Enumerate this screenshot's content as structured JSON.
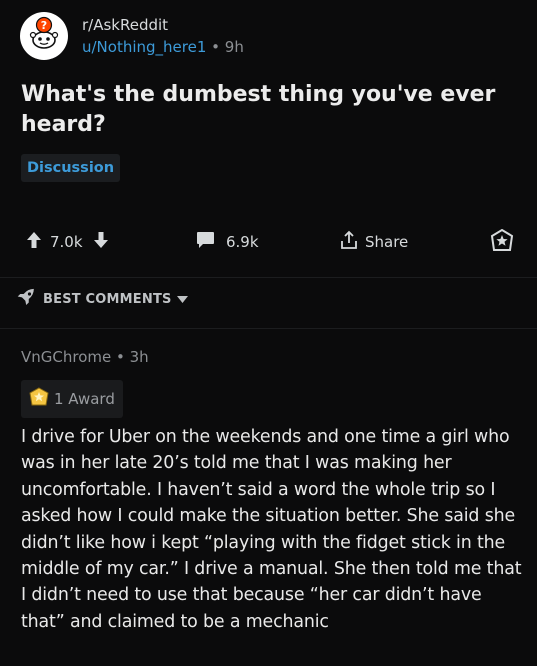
{
  "post": {
    "subreddit": "r/AskReddit",
    "author": "u/Nothing_here1",
    "time": "9h",
    "title": "What's the dumbest thing you've ever heard?",
    "flair": "Discussion",
    "upvotes": "7.0k",
    "comments": "6.9k",
    "share_label": "Share"
  },
  "comments_section": {
    "sort_label": "BEST COMMENTS"
  },
  "comment": {
    "author": "VnGChrome",
    "time": "3h",
    "award": "1 Award",
    "body": "I drive for Uber on the weekends and one time a girl who was in her late 20’s told me that I was making her uncomfortable. I haven’t said a word the whole trip so I asked how I could make the situation better. She said she didn’t like how i kept “playing with the fidget stick in the middle of my car.” I drive a manual. She then told me that I didn’t need to use that because “her car didn’t have that” and claimed to be a mechanic"
  },
  "icons": {
    "avatar": "subreddit-avatar-icon",
    "upvote": "upvote-arrow-icon",
    "downvote": "downvote-arrow-icon",
    "comments": "comment-bubble-icon",
    "share": "share-icon",
    "award_post": "award-icon",
    "rocket": "rocket-icon",
    "chevron": "chevron-down-icon",
    "award_badge": "award-badge-icon"
  },
  "colors": {
    "background": "#0b0b0c",
    "link_blue": "#3d9bd9",
    "text": "#d7dadc",
    "muted": "#8c8f93"
  }
}
